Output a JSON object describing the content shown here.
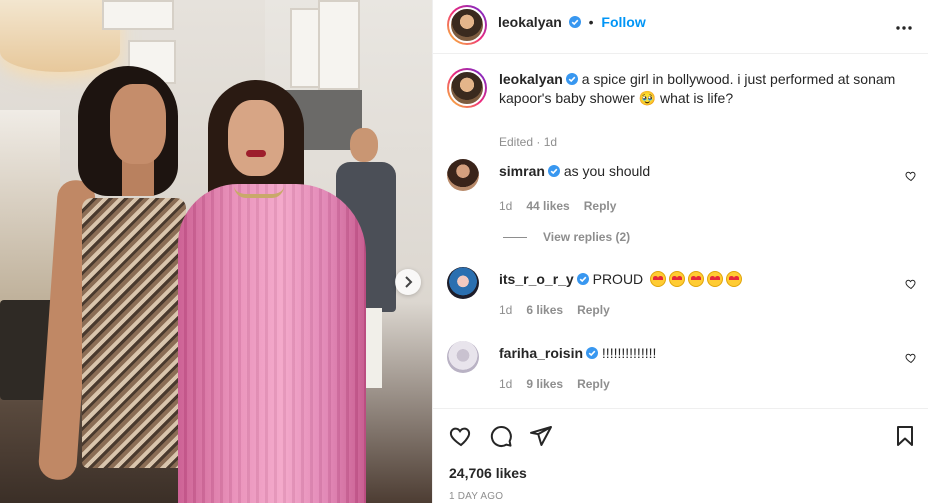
{
  "post": {
    "author": "leokalyan",
    "follow_label": "Follow",
    "separator": "•",
    "more_label": "•••"
  },
  "caption": {
    "username": "leokalyan",
    "text": "a spice girl in bollywood. i just performed at sonam kapoor's baby shower",
    "text_after": "what is life?",
    "emoji": "🥹",
    "meta": "Edited · 1d"
  },
  "comments": [
    {
      "username": "simran",
      "text": "as you should",
      "time": "1d",
      "likes": "44 likes",
      "reply": "Reply",
      "verified": true
    },
    {
      "username": "its_r_o_r_y",
      "text": "PROUD",
      "emoji_count": 5,
      "time": "1d",
      "likes": "6 likes",
      "reply": "Reply",
      "verified": true
    },
    {
      "username": "fariha_roisin",
      "text": "!!!!!!!!!!!!!!",
      "time": "1d",
      "likes": "9 likes",
      "reply": "Reply",
      "verified": true
    }
  ],
  "view_replies": "View replies (2)",
  "footer": {
    "likes": "24,706 likes",
    "date": "1 DAY AGO"
  },
  "colors": {
    "accent": "#0095f6",
    "verified": "#3897f0",
    "muted": "#8e8e8e"
  },
  "icons": [
    "verified-icon",
    "more-icon",
    "heart-icon",
    "comment-icon",
    "share-icon",
    "bookmark-icon",
    "chevron-right-icon"
  ]
}
